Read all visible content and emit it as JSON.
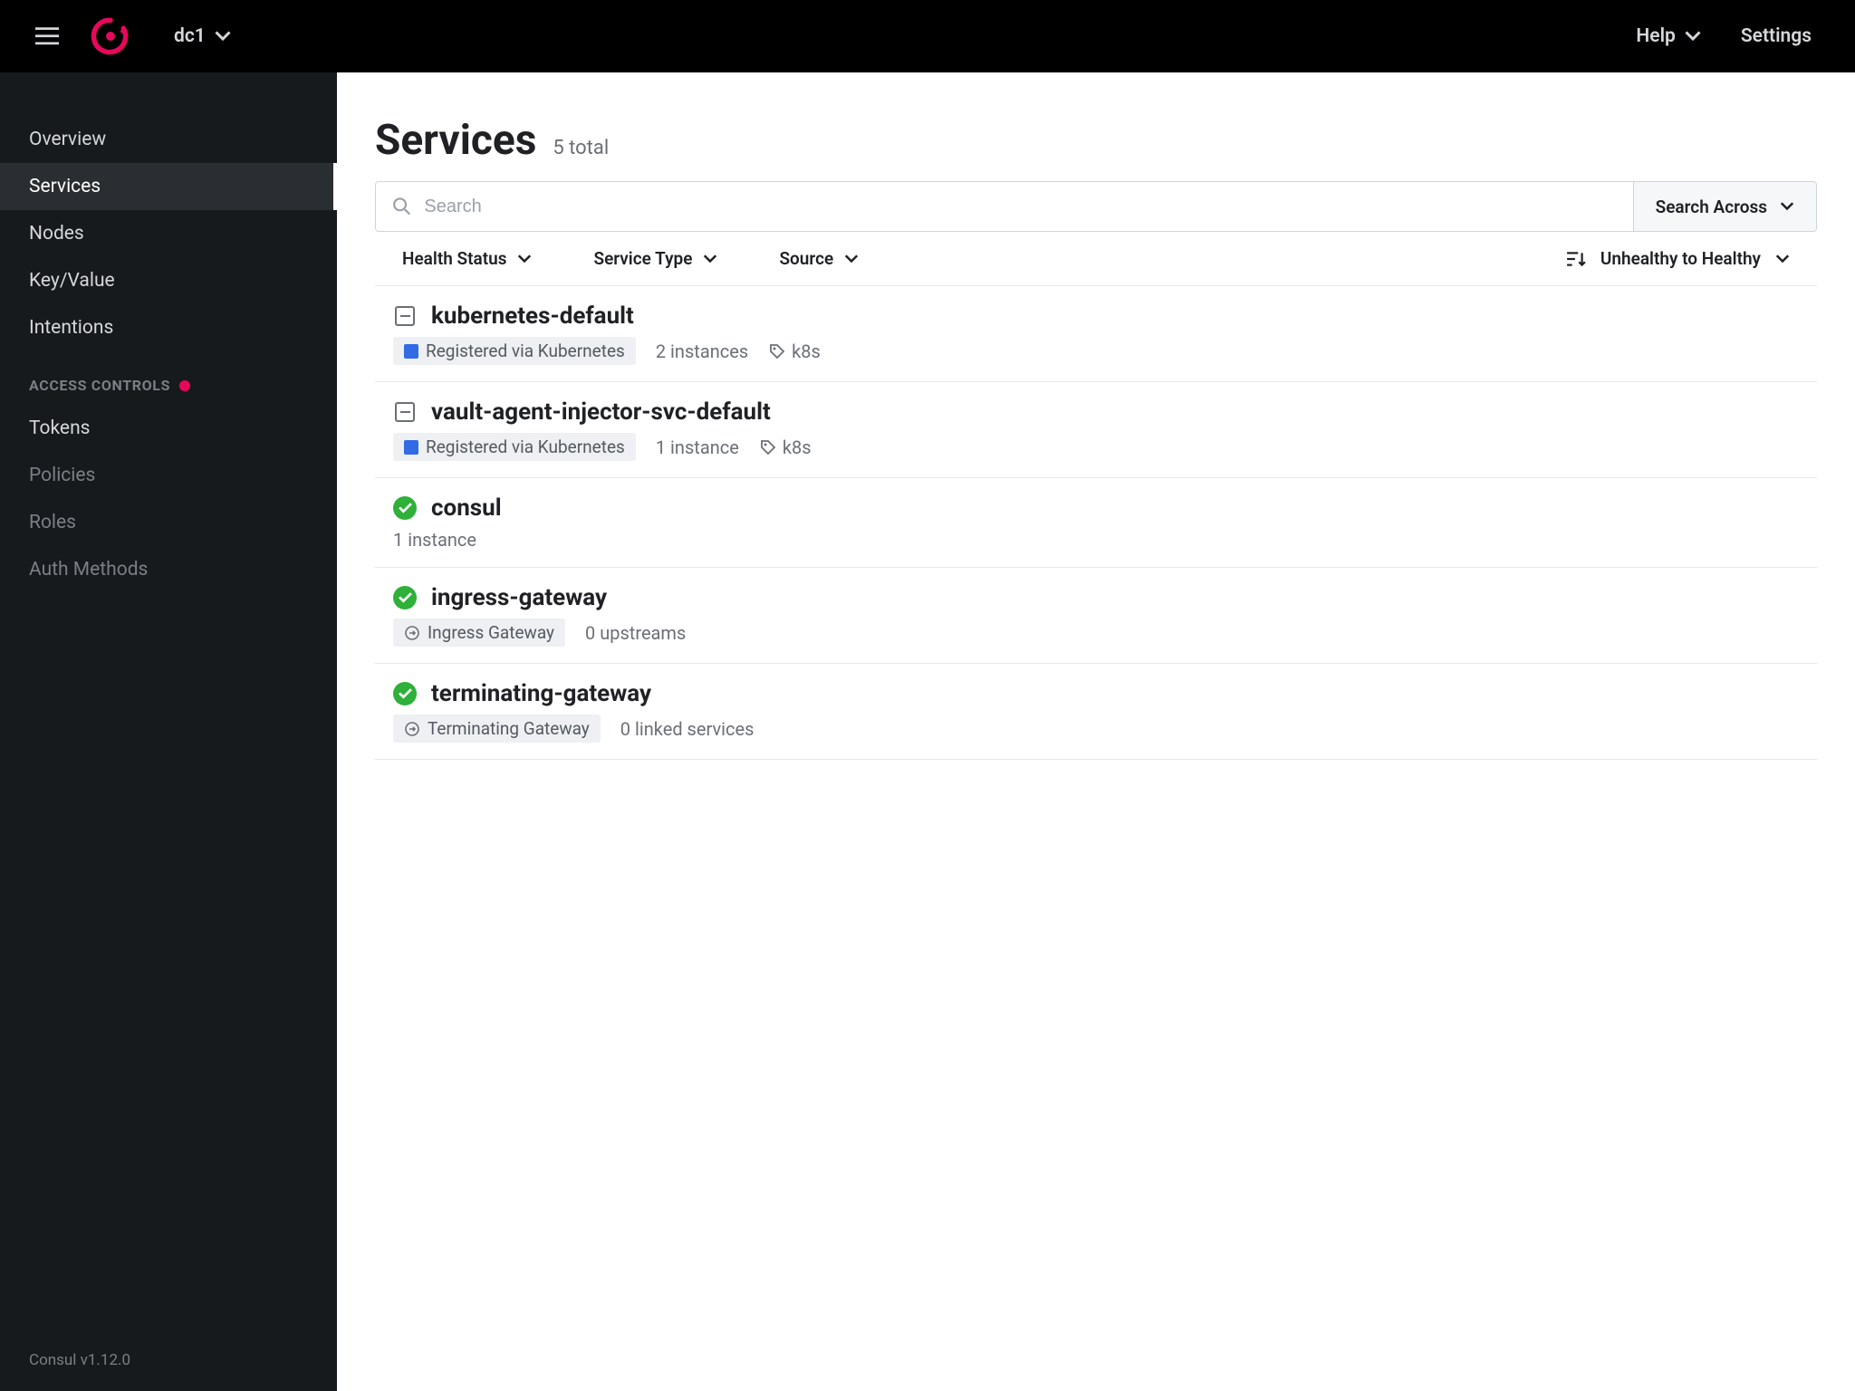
{
  "header": {
    "datacenter": "dc1",
    "help": "Help",
    "settings": "Settings"
  },
  "sidebar": {
    "nav": [
      "Overview",
      "Services",
      "Nodes",
      "Key/Value",
      "Intentions"
    ],
    "active_index": 1,
    "section_title": "ACCESS CONTROLS",
    "access_items": [
      {
        "label": "Tokens",
        "dim": false
      },
      {
        "label": "Policies",
        "dim": true
      },
      {
        "label": "Roles",
        "dim": true
      },
      {
        "label": "Auth Methods",
        "dim": true
      }
    ],
    "footer": "Consul v1.12.0"
  },
  "page": {
    "title": "Services",
    "subtitle": "5 total",
    "search_placeholder": "Search",
    "search_across": "Search Across"
  },
  "filters": {
    "health": "Health Status",
    "service_type": "Service Type",
    "source": "Source",
    "sort": "Unhealthy to Healthy"
  },
  "services": [
    {
      "name": "kubernetes-default",
      "status": "empty",
      "badge": {
        "icon": "k8s",
        "text": "Registered via Kubernetes"
      },
      "instances": "2 instances",
      "tag": "k8s"
    },
    {
      "name": "vault-agent-injector-svc-default",
      "status": "empty",
      "badge": {
        "icon": "k8s",
        "text": "Registered via Kubernetes"
      },
      "instances": "1 instance",
      "tag": "k8s"
    },
    {
      "name": "consul",
      "status": "healthy",
      "instances": "1 instance"
    },
    {
      "name": "ingress-gateway",
      "status": "healthy",
      "badge": {
        "icon": "gateway",
        "text": "Ingress Gateway"
      },
      "instances": "0 upstreams"
    },
    {
      "name": "terminating-gateway",
      "status": "healthy",
      "badge": {
        "icon": "gateway",
        "text": "Terminating Gateway"
      },
      "instances": "0 linked services"
    }
  ]
}
